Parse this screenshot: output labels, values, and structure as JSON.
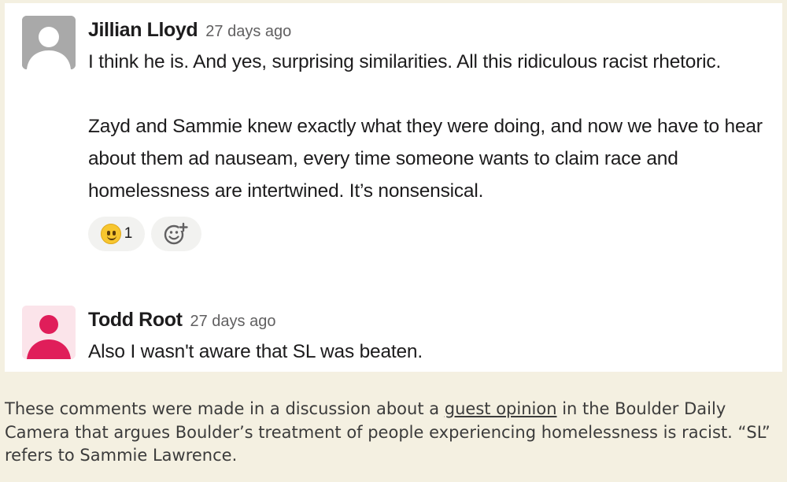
{
  "messages": [
    {
      "author": "Jillian Lloyd",
      "time": "27 days ago",
      "paragraphs": [
        "I think he is. And yes, surprising similarities. All this ridiculous racist rhetoric.",
        "Zayd and Sammie knew exactly what they were doing, and now we have to hear about them ad nauseam, every time someone wants to claim race and homelessness are intertwined. It’s nonsensical."
      ],
      "avatar_icon": "default-avatar-gray",
      "avatar_color": "#a9a9a9",
      "reactions": [
        {
          "emoji_icon": "slightly-smiling-face-icon",
          "count": "1"
        }
      ],
      "add_reaction_icon": "add-reaction-icon"
    },
    {
      "author": "Todd Root",
      "time": "27 days ago",
      "paragraphs": [
        "Also I wasn't aware that SL was beaten."
      ],
      "avatar_icon": "default-avatar-pink",
      "avatar_color": "#e01e5a"
    }
  ],
  "caption": {
    "before_link": "These comments were made in a discussion about a ",
    "link": "guest opinion",
    "after_link": " in the Boulder Daily Camera that argues Boulder’s treatment of people experiencing homelessness is racist. “SL” refers to Sammie Lawrence."
  }
}
